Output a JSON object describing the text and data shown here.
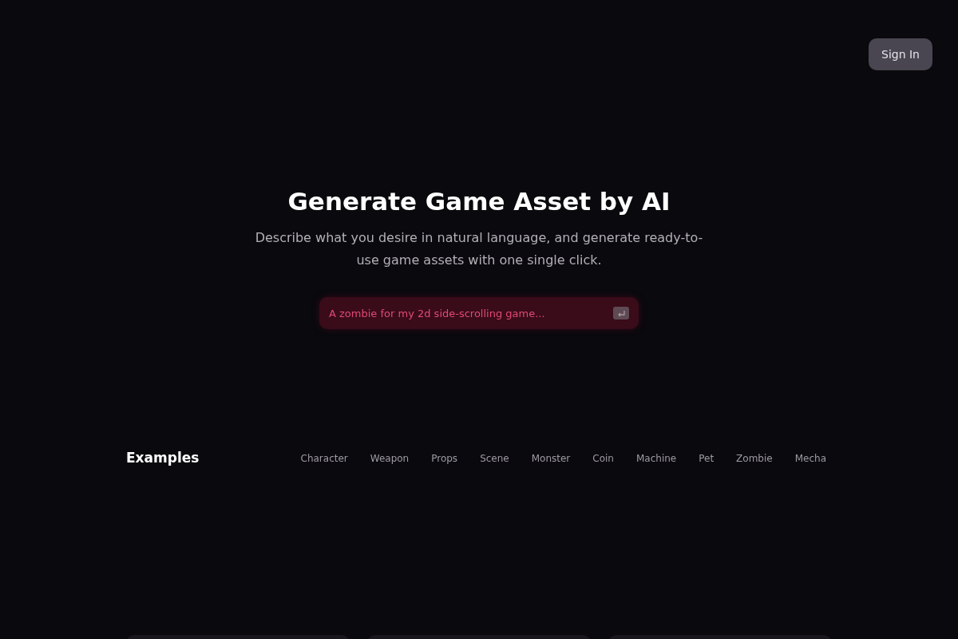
{
  "header": {
    "sign_in_button": "Sign In"
  },
  "hero": {
    "title": "Generate Game Asset by AI",
    "subtitle": "Describe what you desire in natural language, and generate ready-to-use game assets with one single click.",
    "prompt_field": {
      "placeholder": "A zombie for my 2d side-scrolling game..."
    }
  },
  "examples": {
    "heading": "Examples",
    "categories": [
      "Character",
      "Weapon",
      "Props",
      "Scene",
      "Monster",
      "Coin",
      "Machine",
      "Pet",
      "Zombie",
      "Mecha"
    ]
  }
}
